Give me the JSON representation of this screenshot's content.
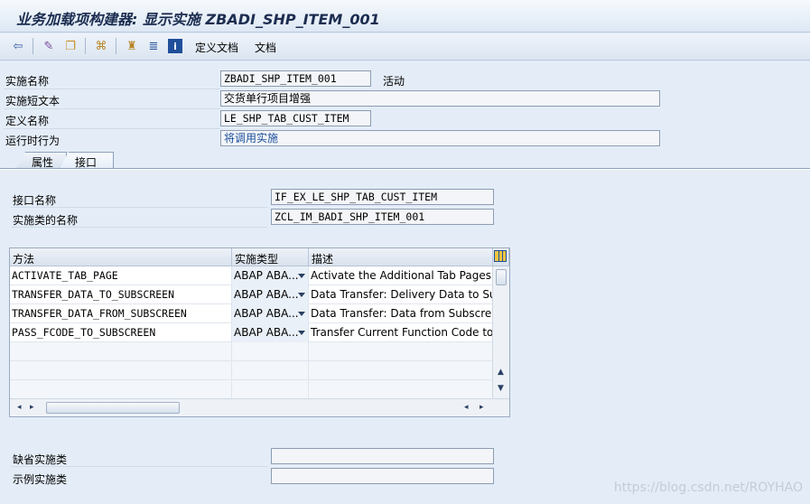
{
  "title": "业务加载项构建器: 显示实施 ZBADI_SHP_ITEM_001",
  "toolbar": {
    "icons": [
      "back-icon",
      "edit-icon",
      "copy-icon",
      "hierarchy-icon",
      "org-icon",
      "list-icon",
      "info-icon"
    ],
    "def_doc": "定义文档",
    "doc": "文档"
  },
  "header": {
    "impl_name_label": "实施名称",
    "impl_name_value": "ZBADI_SHP_ITEM_001",
    "impl_status": "活动",
    "short_text_label": "实施短文本",
    "short_text_value": "交货单行项目增强",
    "def_name_label": "定义名称",
    "def_name_value": "LE_SHP_TAB_CUST_ITEM",
    "runtime_label": "运行时行为",
    "runtime_value": "将调用实施"
  },
  "tabs": [
    {
      "label": "属性"
    },
    {
      "label": "接口"
    }
  ],
  "interface": {
    "iface_label": "接口名称",
    "iface_value": "IF_EX_LE_SHP_TAB_CUST_ITEM",
    "class_label": "实施类的名称",
    "class_value": "ZCL_IM_BADI_SHP_ITEM_001"
  },
  "table": {
    "columns": [
      "方法",
      "实施类型",
      "描述"
    ],
    "rows": [
      {
        "method": "ACTIVATE_TAB_PAGE",
        "type": "ABAP ABA...",
        "desc": "Activate the Additional Tab Pages"
      },
      {
        "method": "TRANSFER_DATA_TO_SUBSCREEN",
        "type": "ABAP ABA...",
        "desc": "Data Transfer: Delivery Data to Subsc"
      },
      {
        "method": "TRANSFER_DATA_FROM_SUBSCREEN",
        "type": "ABAP ABA...",
        "desc": "Data Transfer: Data from Subscreen"
      },
      {
        "method": "PASS_FCODE_TO_SUBSCREEN",
        "type": "ABAP ABA...",
        "desc": "Transfer Current Function Code to S"
      }
    ]
  },
  "footer": {
    "default_label": "缺省实施类",
    "default_value": "",
    "example_label": "示例实施类",
    "example_value": ""
  },
  "watermark": "https://blog.csdn.net/ROYHAO",
  "colors": {
    "title": "#1c2d50",
    "link": "#1a4f9c",
    "background": "#e4edf7"
  }
}
